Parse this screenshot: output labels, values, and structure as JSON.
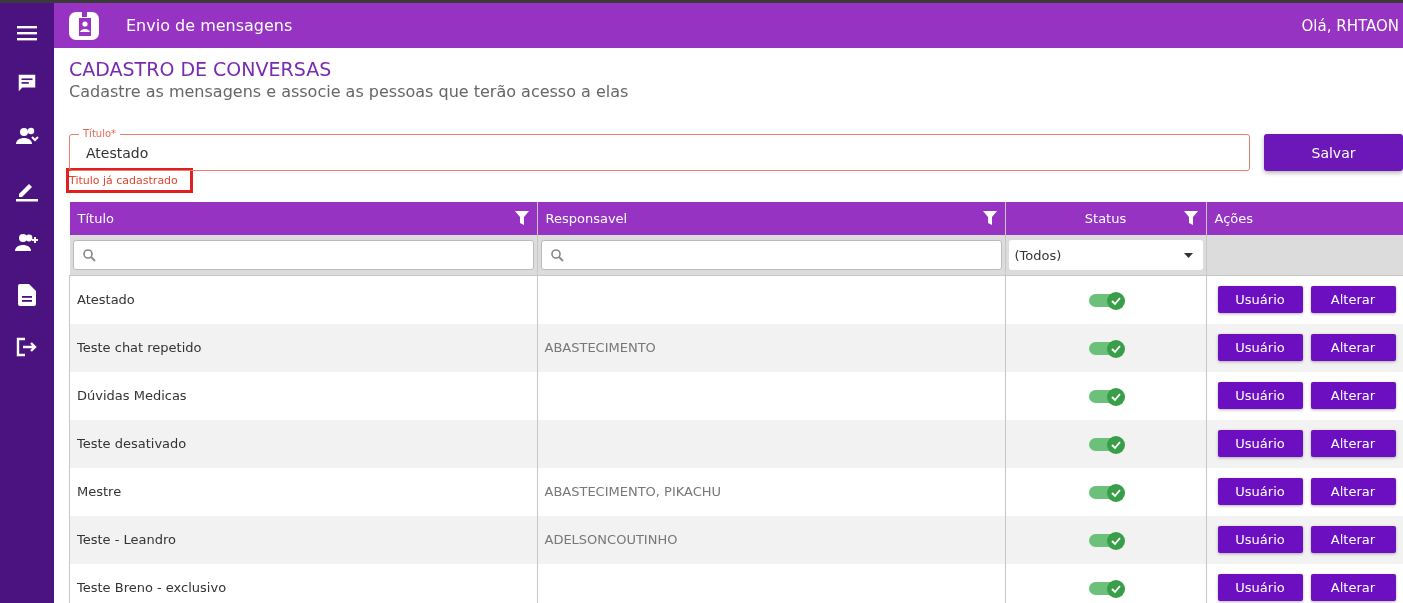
{
  "header": {
    "title": "Envio de mensagens",
    "greeting": "Olá, RHTAON"
  },
  "page": {
    "title": "CADASTRO DE CONVERSAS",
    "subtitle": "Cadastre as mensagens e associe as pessoas que terão acesso a elas"
  },
  "form": {
    "label": "Título*",
    "value": "Atestado",
    "error": "Titulo já cadastrado",
    "highlighted": true,
    "save_button": "Salvar"
  },
  "table": {
    "columns": [
      {
        "label": "Título",
        "filter": true
      },
      {
        "label": "Responsavel",
        "filter": true
      },
      {
        "label": "Status",
        "filter": true
      },
      {
        "label": "Ações",
        "filter": false
      }
    ],
    "filters": [
      {
        "kind": "search"
      },
      {
        "kind": "search"
      },
      {
        "kind": "select",
        "value": "(Todos)"
      },
      {
        "kind": "none"
      }
    ],
    "rows": [
      {
        "title": "Atestado",
        "responsible": "",
        "active": true,
        "actions": [
          "Usuário",
          "Alterar"
        ]
      },
      {
        "title": "Teste chat repetido",
        "responsible": "ABASTECIMENTO",
        "active": true,
        "actions": [
          "Usuário",
          "Alterar"
        ]
      },
      {
        "title": "Dúvidas Medicas",
        "responsible": "",
        "active": true,
        "actions": [
          "Usuário",
          "Alterar"
        ]
      },
      {
        "title": "Teste desativado",
        "responsible": "",
        "active": true,
        "actions": [
          "Usuário",
          "Alterar"
        ]
      },
      {
        "title": "Mestre",
        "responsible": "ABASTECIMENTO, PIKACHU",
        "active": true,
        "actions": [
          "Usuário",
          "Alterar"
        ]
      },
      {
        "title": "Teste - Leandro",
        "responsible": "ADELSONCOUTINHO",
        "active": true,
        "actions": [
          "Usuário",
          "Alterar"
        ]
      },
      {
        "title": "Teste Breno - exclusivo",
        "responsible": "",
        "active": true,
        "actions": [
          "Usuário",
          "Alterar"
        ]
      }
    ]
  }
}
